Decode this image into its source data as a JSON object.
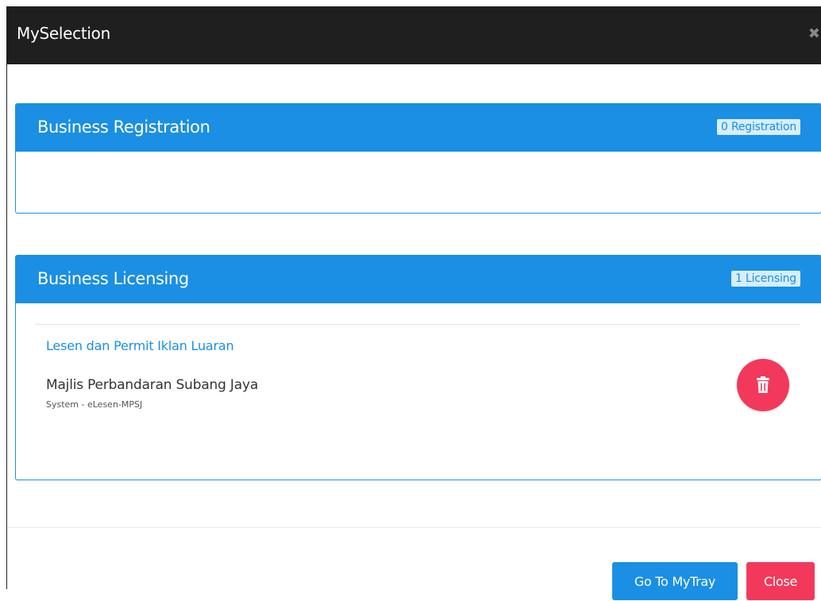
{
  "modal": {
    "title": "MySelection",
    "close_glyph": "✖"
  },
  "registration": {
    "title": "Business Registration",
    "badge": "0 Registration"
  },
  "licensing": {
    "title": "Business Licensing",
    "badge": "1 Licensing",
    "items": [
      {
        "title": "Lesen dan Permit Iklan Luaran",
        "agency": "Majlis Perbandaran Subang Jaya",
        "system": "System - eLesen-MPSJ",
        "action_icon": "trash-icon"
      }
    ]
  },
  "footer": {
    "go_label": "Go To MyTray",
    "close_label": "Close"
  },
  "colors": {
    "header_bg": "#1f1f1f",
    "primary": "#1a8fe3",
    "danger": "#f2395b",
    "badge_bg": "#d7eefc"
  }
}
